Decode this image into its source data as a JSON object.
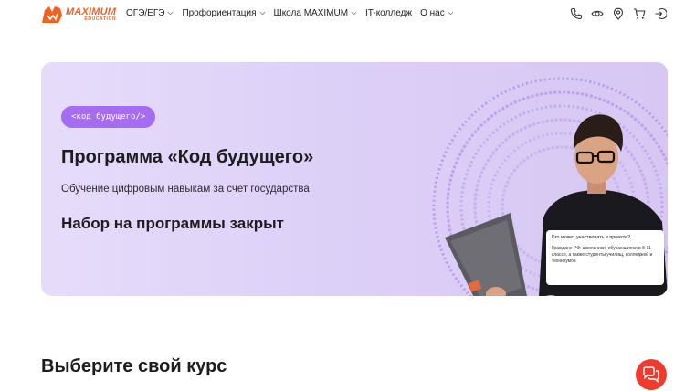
{
  "logo": {
    "title": "MAXIMUM",
    "subtitle": "EDUCATION"
  },
  "nav": [
    {
      "label": "ОГЭ/ЕГЭ",
      "dropdown": true
    },
    {
      "label": "Профориентация",
      "dropdown": true
    },
    {
      "label": "Школа MAXIMUM",
      "dropdown": true
    },
    {
      "label": "IT-колледж",
      "dropdown": false
    },
    {
      "label": "О нас",
      "dropdown": true
    }
  ],
  "header_icons": [
    "phone-icon",
    "eye-icon",
    "location-icon",
    "cart-icon",
    "login-icon"
  ],
  "hero": {
    "badge": "<код будущего/>",
    "title": "Программа «Код будущего»",
    "subtitle": "Обучение цифровым навыкам за счет государства",
    "status": "Набор на программы закрыт",
    "tooltip": {
      "question": "Кто может участвовать в проекте?",
      "answer": "Граждане РФ: школьники, обучающиеся в 8-11 классе, а также студенты училищ, колледжей и техникумов"
    }
  },
  "section": {
    "title": "Выберите свой курс"
  },
  "colors": {
    "brand": "#f0621f",
    "hero_bg": "#e2d6f8",
    "badge": "#a46cf0",
    "chat": "#ef3b2d"
  }
}
